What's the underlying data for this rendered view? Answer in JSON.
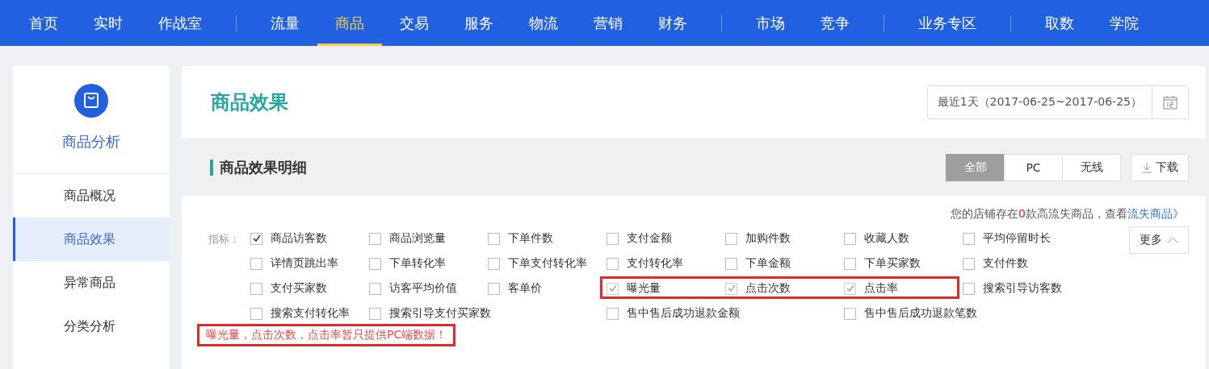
{
  "nav": [
    [
      {
        "label": "首页",
        "selected": false
      },
      {
        "label": "实时",
        "selected": false
      },
      {
        "label": "作战室",
        "selected": false
      }
    ],
    [
      {
        "label": "流量",
        "selected": false
      },
      {
        "label": "商品",
        "selected": true
      },
      {
        "label": "交易",
        "selected": false
      },
      {
        "label": "服务",
        "selected": false
      },
      {
        "label": "物流",
        "selected": false
      },
      {
        "label": "营销",
        "selected": false
      },
      {
        "label": "财务",
        "selected": false
      }
    ],
    [
      {
        "label": "市场",
        "selected": false
      },
      {
        "label": "竞争",
        "selected": false
      }
    ],
    [
      {
        "label": "业务专区",
        "selected": false
      }
    ],
    [
      {
        "label": "取数",
        "selected": false
      },
      {
        "label": "学院",
        "selected": false
      }
    ]
  ],
  "sidebar": {
    "title": "商品分析",
    "items": [
      {
        "label": "商品概况",
        "selected": false
      },
      {
        "label": "商品效果",
        "selected": true
      },
      {
        "label": "异常商品",
        "selected": false
      },
      {
        "label": "分类分析",
        "selected": false
      }
    ]
  },
  "page_title": "商品效果",
  "date_range": "最近1天（2017-06-25~2017-06-25）",
  "section_title": "商品效果明细",
  "device_tabs": [
    {
      "label": "全部",
      "selected": true
    },
    {
      "label": "PC",
      "selected": false
    },
    {
      "label": "无线",
      "selected": false
    }
  ],
  "download_button": "下载",
  "notice_parts": {
    "before": "您的店铺存在",
    "count": "0",
    "after": "款高流失商品，查看",
    "link": "流失商品》"
  },
  "metrics_label": "指标：",
  "more_button": "更多",
  "metric_rows": [
    [
      {
        "label": "商品访客数",
        "checked": true,
        "disabled": false
      },
      {
        "label": "商品浏览量",
        "checked": false,
        "disabled": false
      },
      {
        "label": "下单件数",
        "checked": false,
        "disabled": false
      },
      {
        "label": "支付金额",
        "checked": false,
        "disabled": false
      },
      {
        "label": "加购件数",
        "checked": false,
        "disabled": false
      },
      {
        "label": "收藏人数",
        "checked": false,
        "disabled": false
      },
      {
        "label": "平均停留时长",
        "checked": false,
        "disabled": false
      }
    ],
    [
      {
        "label": "详情页跳出率",
        "checked": false,
        "disabled": false
      },
      {
        "label": "下单转化率",
        "checked": false,
        "disabled": false
      },
      {
        "label": "下单支付转化率",
        "checked": false,
        "disabled": false
      },
      {
        "label": "支付转化率",
        "checked": false,
        "disabled": false
      },
      {
        "label": "下单金额",
        "checked": false,
        "disabled": false
      },
      {
        "label": "下单买家数",
        "checked": false,
        "disabled": false
      },
      {
        "label": "支付件数",
        "checked": false,
        "disabled": false
      }
    ],
    [
      {
        "label": "支付买家数",
        "checked": false,
        "disabled": false
      },
      {
        "label": "访客平均价值",
        "checked": false,
        "disabled": false
      },
      {
        "label": "客单价",
        "checked": false,
        "disabled": false
      },
      {
        "label": "曝光量",
        "checked": true,
        "disabled": true
      },
      {
        "label": "点击次数",
        "checked": true,
        "disabled": true
      },
      {
        "label": "点击率",
        "checked": true,
        "disabled": true
      },
      {
        "label": "搜索引导访客数",
        "checked": false,
        "disabled": false
      }
    ],
    [
      {
        "label": "搜索支付转化率",
        "checked": false,
        "disabled": false
      },
      {
        "label": "搜索引导支付买家数",
        "checked": false,
        "disabled": false,
        "wide": true
      },
      {
        "label": "售中售后成功退款金额",
        "checked": false,
        "disabled": false,
        "wide": true
      },
      {
        "label": "售中售后成功退款笔数",
        "checked": false,
        "disabled": false,
        "wide": true
      }
    ]
  ],
  "pc_only_note": "曝光量，点击次数，点击率暂只提供PC端数据！"
}
